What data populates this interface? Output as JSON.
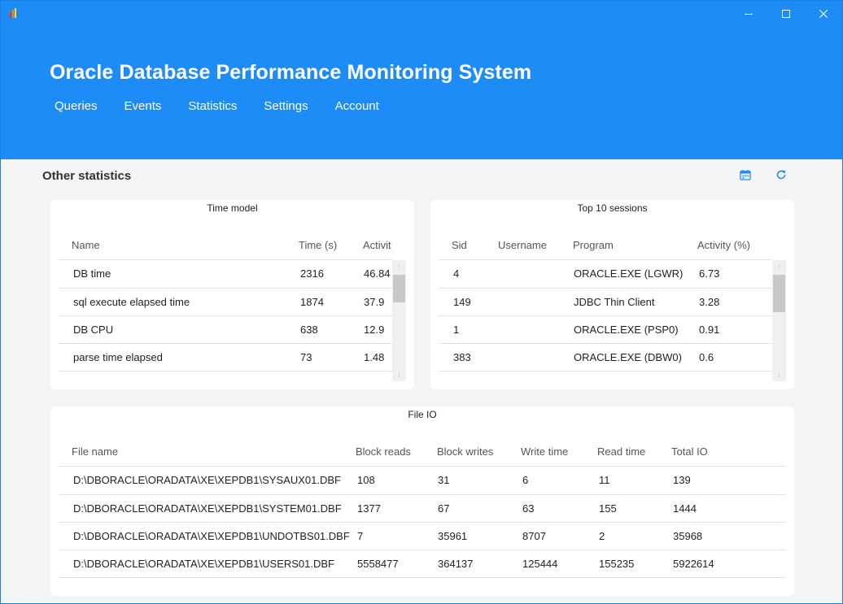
{
  "app": {
    "title": "Oracle Database Performance Monitoring System",
    "icon_colors": [
      "#e53935",
      "#fb8c00",
      "#fdd835",
      "#1e88e5"
    ]
  },
  "nav": {
    "items": [
      "Queries",
      "Events",
      "Statistics",
      "Settings",
      "Account"
    ]
  },
  "page": {
    "section_title": "Other statistics",
    "icons": [
      "calendar-icon",
      "refresh-icon"
    ]
  },
  "colors": {
    "header_bg": "#1e8cf7",
    "accent": "#1e8cf7",
    "background": "#f4f4f4"
  },
  "time_model": {
    "title": "Time model",
    "columns": [
      "Name",
      "Time (s)",
      "Activit"
    ],
    "rows": [
      [
        "DB time",
        "2316",
        "46.84"
      ],
      [
        "sql execute elapsed time",
        "1874",
        "37.9"
      ],
      [
        "DB CPU",
        "638",
        "12.9"
      ],
      [
        "parse time elapsed",
        "73",
        "1.48"
      ]
    ],
    "scroll_position": 0.0
  },
  "top_sessions": {
    "title": "Top 10 sessions",
    "columns": [
      "Sid",
      "Username",
      "Program",
      "Activity (%)"
    ],
    "rows": [
      [
        "4",
        "",
        "ORACLE.EXE (LGWR)",
        "6.73"
      ],
      [
        "149",
        "",
        "JDBC Thin Client",
        "3.28"
      ],
      [
        "1",
        "",
        "ORACLE.EXE (PSP0)",
        "0.91"
      ],
      [
        "383",
        "",
        "ORACLE.EXE (DBW0)",
        "0.6"
      ]
    ],
    "scroll_position": 0.0
  },
  "file_io": {
    "title": "File IO",
    "columns": [
      "File name",
      "Block reads",
      "Block writes",
      "Write time",
      "Read time",
      "Total IO"
    ],
    "rows": [
      [
        "D:\\DBORACLE\\ORADATA\\XE\\XEPDB1\\SYSAUX01.DBF",
        "108",
        "31",
        "6",
        "11",
        "139"
      ],
      [
        "D:\\DBORACLE\\ORADATA\\XE\\XEPDB1\\SYSTEM01.DBF",
        "1377",
        "67",
        "63",
        "155",
        "1444"
      ],
      [
        "D:\\DBORACLE\\ORADATA\\XE\\XEPDB1\\UNDOTBS01.DBF",
        "7",
        "35961",
        "8707",
        "2",
        "35968"
      ],
      [
        "D:\\DBORACLE\\ORADATA\\XE\\XEPDB1\\USERS01.DBF",
        "5558477",
        "364137",
        "125444",
        "155235",
        "5922614"
      ]
    ]
  }
}
